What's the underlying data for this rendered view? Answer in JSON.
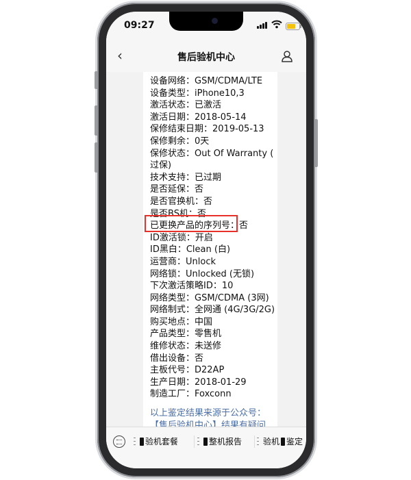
{
  "status": {
    "time": "09:27"
  },
  "nav": {
    "title": "售后验机中心"
  },
  "report_lines": [
    "设备网络：GSM/CDMA/LTE",
    "设备类型：iPhone10,3",
    "激活状态：已激活",
    "激活日期：2018-05-14",
    "保修结束日期：2019-05-13",
    "保修剩余：0天",
    "保修状态：Out Of Warranty (",
    "过保)",
    "技术支持：已过期",
    "是否延保：否",
    "是否官换机：否",
    "是否BS机：否",
    "已更换产品的序列号：否",
    "ID激活锁：开启",
    "ID黑白：Clean (白)",
    "运营商：Unlock",
    "网络锁：Unlocked (无锁)",
    "下次激活策略ID：10",
    "网络类型：GSM/CDMA (3网)",
    "网络制式：全网通 (4G/3G/2G)",
    "购买地点：中国",
    "产品类型：零售机",
    "维修状态：未送修",
    "借出设备：否",
    "主板代号：D22AP",
    "生产日期：2018-01-29",
    "制造工厂：Foxconn"
  ],
  "footer_lines": [
    "以上鉴定结果来源于公众号：",
    "【售后验机中心】结果有疑问"
  ],
  "bottom_menu": {
    "item1": "验机套餐",
    "item2": "整机报告",
    "item3_left": "验机",
    "item3_right": "鉴定"
  },
  "colors": {
    "highlight": "#e8302a",
    "footer_link": "#4c6fa8",
    "battery": "#f4c20d"
  }
}
